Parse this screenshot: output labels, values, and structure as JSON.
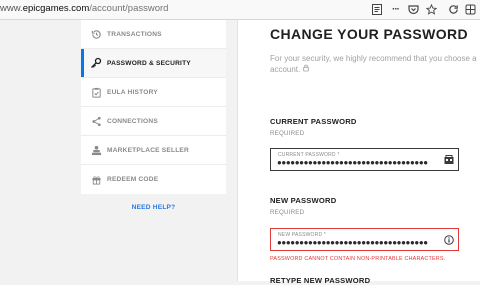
{
  "browser": {
    "url_prefix": "www.",
    "url_domain": "epicgames.com",
    "url_path": "/account/password",
    "toolbar_icons": [
      "reader-view-icon",
      "more-actions-icon",
      "pocket-icon",
      "bookmark-star-icon",
      "reload-icon",
      "extension-icon"
    ]
  },
  "sidebar": {
    "items": [
      {
        "label": "TRANSACTIONS",
        "icon": "history-icon",
        "active": false
      },
      {
        "label": "PASSWORD & SECURITY",
        "icon": "key-icon",
        "active": true
      },
      {
        "label": "EULA HISTORY",
        "icon": "clipboard-icon",
        "active": false
      },
      {
        "label": "CONNECTIONS",
        "icon": "share-icon",
        "active": false
      },
      {
        "label": "MARKETPLACE SELLER",
        "icon": "seller-icon",
        "active": false
      },
      {
        "label": "REDEEM CODE",
        "icon": "gift-icon",
        "active": false
      }
    ],
    "need_help": "NEED HELP?"
  },
  "main": {
    "title": "CHANGE YOUR PASSWORD",
    "description_line1": "For your security, we highly recommend that you choose a",
    "description_line2": "account.",
    "current_password": {
      "heading": "CURRENT PASSWORD",
      "sub": "REQUIRED",
      "field_label": "CURRENT PASSWORD *",
      "value": "●●●●●●●●●●●●●●●●●●●●●●●●●●●●●●●●●●"
    },
    "new_password": {
      "heading": "NEW PASSWORD",
      "sub": "REQUIRED",
      "field_label": "NEW PASSWORD *",
      "value": "●●●●●●●●●●●●●●●●●●●●●●●●●●●●●●●●●●",
      "error": "PASSWORD CANNOT CONTAIN NON-PRINTABLE CHARACTERS."
    },
    "retype_password": {
      "heading": "RETYPE NEW PASSWORD"
    }
  },
  "colors": {
    "accent": "#0078f2",
    "error": "#e03a3a",
    "link": "#2a7ae2"
  }
}
